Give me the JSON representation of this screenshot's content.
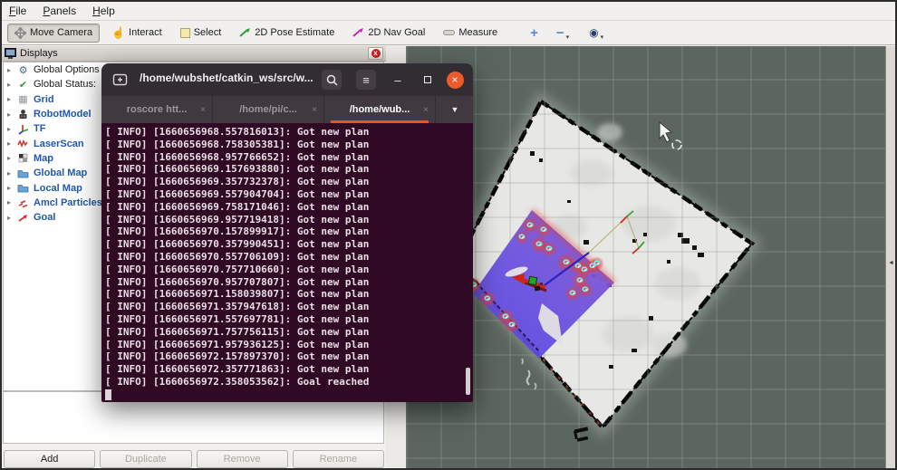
{
  "menu": {
    "items": [
      {
        "label": "File"
      },
      {
        "label": "Panels"
      },
      {
        "label": "Help"
      }
    ]
  },
  "toolbar": {
    "tools": [
      {
        "label": "Move Camera",
        "icon": "move-camera-icon",
        "active": true
      },
      {
        "label": "Interact",
        "icon": "hand-icon",
        "active": false
      },
      {
        "label": "Select",
        "icon": "select-box-icon",
        "active": false
      },
      {
        "label": "2D Pose Estimate",
        "icon": "green-arrow-icon",
        "active": false
      },
      {
        "label": "2D Nav Goal",
        "icon": "magenta-arrow-icon",
        "active": false
      },
      {
        "label": "Measure",
        "icon": "measure-icon",
        "active": false
      }
    ],
    "zoom_in_glyph": "+",
    "zoom_out_glyph": "−",
    "focus_glyph": "◉",
    "caret_glyph": "▾"
  },
  "displays_panel": {
    "title": "Displays",
    "close_glyph": "x",
    "expander_glyph": "▸",
    "items": [
      {
        "label": "Global Options",
        "icon": "gear-icon",
        "style": "plain",
        "glyph": "⚙"
      },
      {
        "label": "Global Status:",
        "icon": "check-icon",
        "style": "plain",
        "glyph": "✔"
      },
      {
        "label": "Grid",
        "icon": "grid-icon",
        "style": "blue",
        "glyph": "▦"
      },
      {
        "label": "RobotModel",
        "icon": "robot-icon",
        "style": "blue",
        "glyph": ""
      },
      {
        "label": "TF",
        "icon": "axes-icon",
        "style": "blue",
        "glyph": ""
      },
      {
        "label": "LaserScan",
        "icon": "laser-icon",
        "style": "blue",
        "glyph": ""
      },
      {
        "label": "Map",
        "icon": "map-icon",
        "style": "blue",
        "glyph": ""
      },
      {
        "label": "Global Map",
        "icon": "folder-icon",
        "style": "blue",
        "glyph": ""
      },
      {
        "label": "Local Map",
        "icon": "folder-icon",
        "style": "blue",
        "glyph": ""
      },
      {
        "label": "Amcl Particles",
        "icon": "particles-icon",
        "style": "blue",
        "glyph": ""
      },
      {
        "label": "Goal",
        "icon": "goal-arrow-icon",
        "style": "blue",
        "glyph": ""
      }
    ],
    "buttons": [
      {
        "label": "Add",
        "enabled": true
      },
      {
        "label": "Duplicate",
        "enabled": false
      },
      {
        "label": "Remove",
        "enabled": false
      },
      {
        "label": "Rename",
        "enabled": false
      }
    ]
  },
  "terminal": {
    "title": "/home/wubshet/catkin_ws/src/w...",
    "tabs": [
      {
        "label": "roscore htt...",
        "active": false
      },
      {
        "label": "/home/pi/c...",
        "active": false
      },
      {
        "label": "/home/wub...",
        "active": true
      }
    ],
    "tab_close_glyph": "×",
    "dropdown_glyph": "▼",
    "menu_glyph": "≡",
    "minimize_glyph": "–",
    "close_glyph": "×",
    "lines": [
      "[ INFO] [1660656968.557816013]: Got new plan",
      "[ INFO] [1660656968.758305381]: Got new plan",
      "[ INFO] [1660656968.957766652]: Got new plan",
      "[ INFO] [1660656969.157693880]: Got new plan",
      "[ INFO] [1660656969.357732378]: Got new plan",
      "[ INFO] [1660656969.557904704]: Got new plan",
      "[ INFO] [1660656969.758171046]: Got new plan",
      "[ INFO] [1660656969.957719418]: Got new plan",
      "[ INFO] [1660656970.157899917]: Got new plan",
      "[ INFO] [1660656970.357990451]: Got new plan",
      "[ INFO] [1660656970.557706109]: Got new plan",
      "[ INFO] [1660656970.757710660]: Got new plan",
      "[ INFO] [1660656970.957707807]: Got new plan",
      "[ INFO] [1660656971.158039807]: Got new plan",
      "[ INFO] [1660656971.357947618]: Got new plan",
      "[ INFO] [1660656971.557697781]: Got new plan",
      "[ INFO] [1660656971.757756115]: Got new plan",
      "[ INFO] [1660656971.957936125]: Got new plan",
      "[ INFO] [1660656972.157897370]: Got new plan",
      "[ INFO] [1660656972.357771863]: Got new plan",
      "[ INFO] [1660656972.358053562]: Goal reached"
    ]
  },
  "side_strip": {
    "collapse_glyph": "◄"
  },
  "colors": {
    "accent_orange": "#e95420",
    "terminal_bg": "#300a24",
    "map_background": "#5a665f",
    "display_name_blue": "#2157ae",
    "costmap_blue": "#5346e2",
    "costmap_hot_red": "#dd4238",
    "obstacle_cyan": "#72f4ff",
    "robot_red": "#cf2517"
  }
}
